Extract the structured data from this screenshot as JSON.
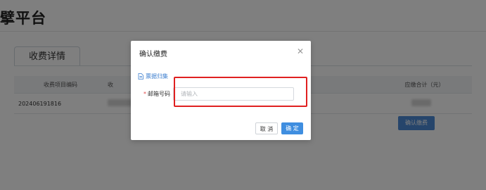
{
  "app": {
    "brand": "擘平台"
  },
  "page": {
    "tab_label": "收费详情",
    "table": {
      "headers": [
        "收费项目编码",
        "收",
        "",
        "应缴合计（元）"
      ],
      "rows": [
        {
          "code": "202406191816"
        }
      ]
    },
    "confirm_pay_button": "确认缴费"
  },
  "dialog": {
    "title": "确认缴费",
    "close_icon": "close-icon",
    "doc_link": "票据归集",
    "doc_icon": "document-icon",
    "field_label": "邮箱号码",
    "field_placeholder": "请输入",
    "field_value": "",
    "cancel_label": "取 消",
    "ok_label": "确 定"
  },
  "colors": {
    "primary": "#3f8ee0",
    "highlight": "#e02020",
    "required": "#e14b4b"
  }
}
